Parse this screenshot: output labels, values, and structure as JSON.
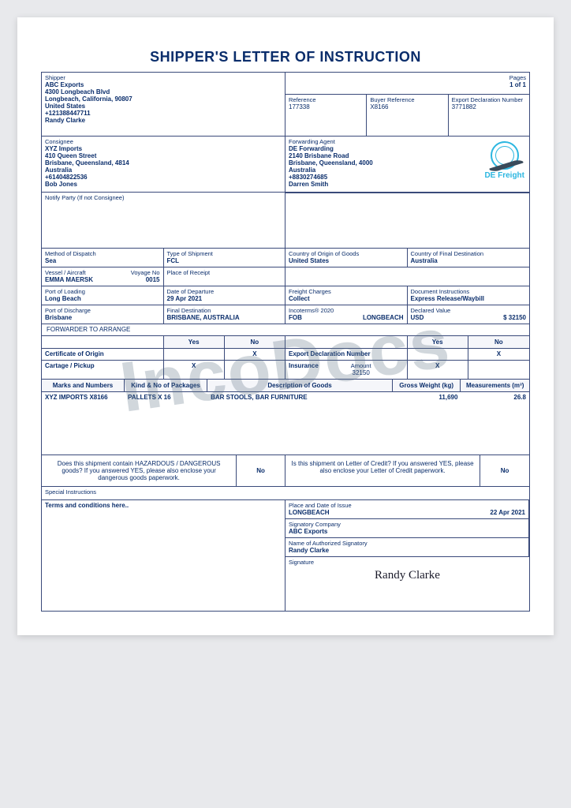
{
  "title": "SHIPPER'S LETTER OF INSTRUCTION",
  "watermark": "IncoDocs",
  "pages": {
    "label": "Pages",
    "value": "1 of 1"
  },
  "shipper": {
    "label": "Shipper",
    "name": "ABC Exports",
    "addr1": "4300 Longbeach Blvd",
    "addr2": "Longbeach, California, 90807",
    "country": "United States",
    "phone": "+121388447711",
    "contact": "Randy Clarke"
  },
  "reference": {
    "label": "Reference",
    "value": "177338"
  },
  "buyer_ref": {
    "label": "Buyer Reference",
    "value": "X8166"
  },
  "export_decl": {
    "label": "Export Declaration Number",
    "value": "3771882"
  },
  "consignee": {
    "label": "Consignee",
    "name": "XYZ Imports",
    "addr1": "410 Queen Street",
    "addr2": "Brisbane, Queensland, 4814",
    "country": "Australia",
    "phone": "+61404822536",
    "contact": "Bob Jones"
  },
  "forwarder": {
    "label": "Forwarding Agent",
    "name": "DE Forwarding",
    "addr1": "2140 Brisbane Road",
    "addr2": "Brisbane, Queensland, 4000",
    "country": "Australia",
    "phone": "+8830274685",
    "contact": "Darren Smith"
  },
  "logo_text": "DE Freight",
  "notify": {
    "label": "Notify Party (If not Consignee)"
  },
  "dispatch": {
    "label": "Method of Dispatch",
    "value": "Sea"
  },
  "shiptype": {
    "label": "Type of Shipment",
    "value": "FCL"
  },
  "origin": {
    "label": "Country of Origin of Goods",
    "value": "United States"
  },
  "finaldest_country": {
    "label": "Country of Final Destination",
    "value": "Australia"
  },
  "vessel": {
    "label": "Vessel / Aircraft",
    "value": "EMMA MAERSK"
  },
  "voyage": {
    "label": "Voyage No",
    "value": "0015"
  },
  "receipt": {
    "label": "Place of Receipt"
  },
  "port_loading": {
    "label": "Port of Loading",
    "value": "Long Beach"
  },
  "departure": {
    "label": "Date of Departure",
    "value": "29 Apr 2021"
  },
  "freight": {
    "label": "Freight Charges",
    "value": "Collect"
  },
  "doc_instr": {
    "label": "Document Instructions",
    "value": "Express Release/Waybill"
  },
  "port_discharge": {
    "label": "Port of Discharge",
    "value": "Brisbane"
  },
  "final_dest": {
    "label": "Final Destination",
    "value": "BRISBANE, AUSTRALIA"
  },
  "incoterms": {
    "label": "Incoterms® 2020",
    "term": "FOB",
    "place": "LONGBEACH"
  },
  "declared": {
    "label": "Declared Value",
    "currency": "USD",
    "amount": "$ 32150"
  },
  "arrange_label": "FORWARDER TO ARRANGE",
  "yn": {
    "yes": "Yes",
    "no": "No"
  },
  "coo": {
    "label": "Certificate of Origin",
    "yes": "",
    "no": "X"
  },
  "edn": {
    "label": "Export Declaration Number",
    "yes": "",
    "no": "X"
  },
  "cartage": {
    "label": "Cartage / Pickup",
    "yes": "X",
    "no": ""
  },
  "insurance": {
    "label": "Insurance",
    "sub": "Amount",
    "value": "32150",
    "yes": "X",
    "no": ""
  },
  "table": {
    "headers": {
      "marks": "Marks and Numbers",
      "kind": "Kind & No of Packages",
      "desc": "Description of Goods",
      "gross": "Gross Weight (kg)",
      "meas": "Measurements (m³)"
    },
    "rows": [
      {
        "marks": "XYZ IMPORTS X8166",
        "kind": "PALLETS X 16",
        "desc": "BAR STOOLS, BAR FURNITURE",
        "gross": "11,690",
        "meas": "26.8"
      }
    ]
  },
  "hazard": {
    "q": "Does this shipment contain HAZARDOUS / DANGEROUS goods? If you answered YES, please also enclose your dangerous goods paperwork.",
    "a": "No"
  },
  "loc": {
    "q": "Is this shipment on Letter of Credit? If you answered YES, please also enclose your Letter of Credit paperwork.",
    "a": "No"
  },
  "special": {
    "label": "Special Instructions"
  },
  "terms": {
    "label": "Terms and conditions here.."
  },
  "issue": {
    "label": "Place and Date of Issue",
    "place": "LONGBEACH",
    "date": "22 Apr 2021"
  },
  "sig_company": {
    "label": "Signatory Company",
    "value": "ABC Exports"
  },
  "sig_name": {
    "label": "Name of Authorized Signatory",
    "value": "Randy   Clarke"
  },
  "signature": {
    "label": "Signature",
    "value": "Randy Clarke"
  }
}
